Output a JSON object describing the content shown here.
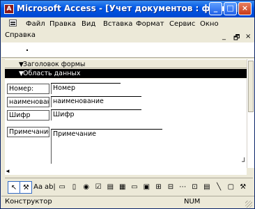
{
  "window": {
    "title": "Microsoft Access - [Учет документов : форма]",
    "app_icon_letter": "A"
  },
  "titlebar_buttons": {
    "minimize": "_",
    "maximize": "□",
    "close": "×"
  },
  "menu": {
    "items": [
      {
        "label": "Файл"
      },
      {
        "label": "Правка"
      },
      {
        "label": "Вид"
      },
      {
        "label": "Вставка"
      },
      {
        "label": "Формат"
      },
      {
        "label": "Сервис"
      },
      {
        "label": "Окно"
      },
      {
        "label": "Справка"
      }
    ],
    "mdi_minimize": "_",
    "mdi_restore": "🗗",
    "mdi_close": "×"
  },
  "sections": {
    "header": "Заголовок формы",
    "detail": "Область данных"
  },
  "form_controls": [
    {
      "label": "Номер:",
      "field": "Номер"
    },
    {
      "label": "наименование",
      "field": "наименование"
    },
    {
      "label": "Шифр",
      "field": "Шифр"
    },
    {
      "label": "Примечание",
      "field": "Примечание"
    }
  ],
  "toolbox": {
    "tools": [
      {
        "icon": "arrow-select-icon",
        "glyph": "↖"
      },
      {
        "icon": "wizard-icon",
        "glyph": "⚒"
      },
      {
        "icon": "label-icon",
        "glyph": "Aa"
      },
      {
        "icon": "textbox-icon",
        "glyph": "ab|"
      },
      {
        "icon": "option-group-icon",
        "glyph": "▭"
      },
      {
        "icon": "toggle-icon",
        "glyph": "▯"
      },
      {
        "icon": "radio-icon",
        "glyph": "◉"
      },
      {
        "icon": "checkbox-icon",
        "glyph": "☑"
      },
      {
        "icon": "combobox-icon",
        "glyph": "▤"
      },
      {
        "icon": "listbox-icon",
        "glyph": "▦"
      },
      {
        "icon": "button-icon",
        "glyph": "▭"
      },
      {
        "icon": "image-icon",
        "glyph": "▣"
      },
      {
        "icon": "unbound-frame-icon",
        "glyph": "⊞"
      },
      {
        "icon": "bound-frame-icon",
        "glyph": "⊟"
      },
      {
        "icon": "page-break-icon",
        "glyph": "⋯"
      },
      {
        "icon": "tab-control-icon",
        "glyph": "⊡"
      },
      {
        "icon": "subform-icon",
        "glyph": "▤"
      },
      {
        "icon": "line-icon",
        "glyph": "╲"
      },
      {
        "icon": "rectangle-icon",
        "glyph": "▢"
      },
      {
        "icon": "more-controls-icon",
        "glyph": "⚒"
      }
    ]
  },
  "status": {
    "mode": "Конструктор",
    "num": "NUM"
  }
}
